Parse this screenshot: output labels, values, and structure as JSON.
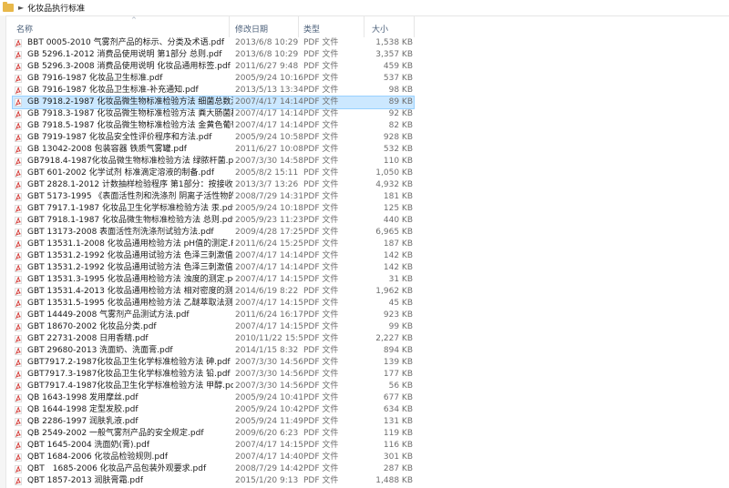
{
  "address": {
    "folder_name": "化妆品执行标准"
  },
  "columns": {
    "name": "名称",
    "date": "修改日期",
    "type": "类型",
    "size": "大小"
  },
  "files": [
    {
      "name": "BBT 0005-2010 气雾剂产品的标示、分类及术语.pdf",
      "date": "2013/6/8 10:29",
      "type": "PDF 文件",
      "size": "1,538 KB"
    },
    {
      "name": "GB 5296.1-2012 消费品使用说明 第1部分 总则.pdf",
      "date": "2013/6/8 10:29",
      "type": "PDF 文件",
      "size": "3,357 KB"
    },
    {
      "name": "GB 5296.3-2008 消费品使用说明 化妆品通用标签.pdf",
      "date": "2011/6/27 9:48",
      "type": "PDF 文件",
      "size": "459 KB"
    },
    {
      "name": "GB 7916-1987 化妆品卫生标准.pdf",
      "date": "2005/9/24 10:16",
      "type": "PDF 文件",
      "size": "537 KB"
    },
    {
      "name": "GB 7916-1987 化妆品卫生标准-补充通知.pdf",
      "date": "2013/5/13 13:34",
      "type": "PDF 文件",
      "size": "98 KB"
    },
    {
      "name": "GB 7918.2-1987 化妆品微生物标准检验方法 细菌总数测定.pdf",
      "date": "2007/4/17 14:14",
      "type": "PDF 文件",
      "size": "89 KB"
    },
    {
      "name": "GB 7918.3-1987 化妆品微生物标准检验方法 粪大肠菌群.pdf",
      "date": "2007/4/17 14:14",
      "type": "PDF 文件",
      "size": "92 KB"
    },
    {
      "name": "GB 7918.5-1987 化妆品微生物标准检验方法 金黄色葡萄球菌.pdf",
      "date": "2007/4/17 14:14",
      "type": "PDF 文件",
      "size": "82 KB"
    },
    {
      "name": "GB 7919-1987 化妆品安全性评价程序和方法.pdf",
      "date": "2005/9/24 10:58",
      "type": "PDF 文件",
      "size": "928 KB"
    },
    {
      "name": "GB 13042-2008 包装容器 铁质气雾罐.pdf",
      "date": "2011/6/27 10:08",
      "type": "PDF 文件",
      "size": "532 KB"
    },
    {
      "name": "GB7918.4-1987化妆品微生物标准检验方法 绿脓杆菌.pdf",
      "date": "2007/3/30 14:58",
      "type": "PDF 文件",
      "size": "110 KB"
    },
    {
      "name": "GBT 601-2002 化学试剂 标准滴定溶液的制备.pdf",
      "date": "2005/8/2 15:11",
      "type": "PDF 文件",
      "size": "1,050 KB"
    },
    {
      "name": "GBT 2828.1-2012 计数抽样检验程序 第1部分：按接收质量限...",
      "date": "2013/3/7 13:26",
      "type": "PDF 文件",
      "size": "4,932 KB"
    },
    {
      "name": "GBT 5173-1995 《表面活性剂和洗涤剂 阴离子活性物的测定 ...",
      "date": "2008/7/29 14:31",
      "type": "PDF 文件",
      "size": "181 KB"
    },
    {
      "name": "GBT 7917.1-1987 化妆品卫生化学标准检验方法 汞.pdf",
      "date": "2005/9/24 10:18",
      "type": "PDF 文件",
      "size": "125 KB"
    },
    {
      "name": "GBT 7918.1-1987 化妆品微生物标准检验方法 总则.pdf",
      "date": "2005/9/23 11:23",
      "type": "PDF 文件",
      "size": "440 KB"
    },
    {
      "name": "GBT 13173-2008 表面活性剂洗涤剂试验方法.pdf",
      "date": "2009/4/28 17:25",
      "type": "PDF 文件",
      "size": "6,965 KB"
    },
    {
      "name": "GBT 13531.1-2008 化妆品通用检验方法 pH值的测定.PDF",
      "date": "2011/6/24 15:25",
      "type": "PDF 文件",
      "size": "187 KB"
    },
    {
      "name": "GBT 13531.2-1992 化妆品通用试验方法 色泽三刺激值和色差Δ...",
      "date": "2007/4/17 14:14",
      "type": "PDF 文件",
      "size": "142 KB"
    },
    {
      "name": "GBT 13531.2-1992 化妆品通用试验方法 色泽三刺激值和色差Δ...",
      "date": "2007/4/17 14:14",
      "type": "PDF 文件",
      "size": "142 KB"
    },
    {
      "name": "GBT 13531.3-1995 化妆品通用检验方法 浊度的测定.pdf",
      "date": "2007/4/17 14:15",
      "type": "PDF 文件",
      "size": "31 KB"
    },
    {
      "name": "GBT 13531.4-2013 化妆品通用检验方法 相对密度的测定.pdf",
      "date": "2014/6/19 8:22",
      "type": "PDF 文件",
      "size": "1,962 KB"
    },
    {
      "name": "GBT 13531.5-1995 化妆品通用检验方法 乙醚萃取法测定香水、...",
      "date": "2007/4/17 14:15",
      "type": "PDF 文件",
      "size": "45 KB"
    },
    {
      "name": "GBT 14449-2008 气雾剂产品测试方法.pdf",
      "date": "2011/6/24 16:17",
      "type": "PDF 文件",
      "size": "923 KB"
    },
    {
      "name": "GBT 18670-2002 化妆品分类.pdf",
      "date": "2007/4/17 14:15",
      "type": "PDF 文件",
      "size": "99 KB"
    },
    {
      "name": "GBT 22731-2008 日用香精.pdf",
      "date": "2010/11/22 15:52",
      "type": "PDF 文件",
      "size": "2,227 KB"
    },
    {
      "name": "GBT 29680-2013 洗面奶、洗面膏.pdf",
      "date": "2014/1/15 8:32",
      "type": "PDF 文件",
      "size": "894 KB"
    },
    {
      "name": "GBT7917.2-1987化妆品卫生化学标准检验方法 砷.pdf",
      "date": "2007/3/30 14:56",
      "type": "PDF 文件",
      "size": "139 KB"
    },
    {
      "name": "GBT7917.3-1987化妆品卫生化学标准检验方法 铅.pdf",
      "date": "2007/3/30 14:56",
      "type": "PDF 文件",
      "size": "177 KB"
    },
    {
      "name": "GBT7917.4-1987化妆品卫生化学标准检验方法 甲醇.pdf",
      "date": "2007/3/30 14:56",
      "type": "PDF 文件",
      "size": "56 KB"
    },
    {
      "name": "QB 1643-1998 发用摩丝.pdf",
      "date": "2005/9/24 10:41",
      "type": "PDF 文件",
      "size": "677 KB"
    },
    {
      "name": "QB 1644-1998 定型发胶.pdf",
      "date": "2005/9/24 10:42",
      "type": "PDF 文件",
      "size": "634 KB"
    },
    {
      "name": "QB 2286-1997 润肤乳液.pdf",
      "date": "2005/9/24 11:49",
      "type": "PDF 文件",
      "size": "131 KB"
    },
    {
      "name": "QB 2549-2002 一般气雾剂产品的安全规定.pdf",
      "date": "2009/6/20 6:23",
      "type": "PDF 文件",
      "size": "119 KB"
    },
    {
      "name": "QBT 1645-2004 洗面奶(膏).pdf",
      "date": "2007/4/17 14:15",
      "type": "PDF 文件",
      "size": "116 KB"
    },
    {
      "name": "QBT 1684-2006 化妆品检验规则.pdf",
      "date": "2007/4/17 14:40",
      "type": "PDF 文件",
      "size": "301 KB"
    },
    {
      "name": "QBT　1685-2006 化妆品产品包装外观要求.pdf",
      "date": "2008/7/29 14:42",
      "type": "PDF 文件",
      "size": "287 KB"
    },
    {
      "name": "QBT 1857-2013 润肤膏霜.pdf",
      "date": "2015/1/20 9:13",
      "type": "PDF 文件",
      "size": "1,488 KB"
    }
  ],
  "selected_index": 5
}
